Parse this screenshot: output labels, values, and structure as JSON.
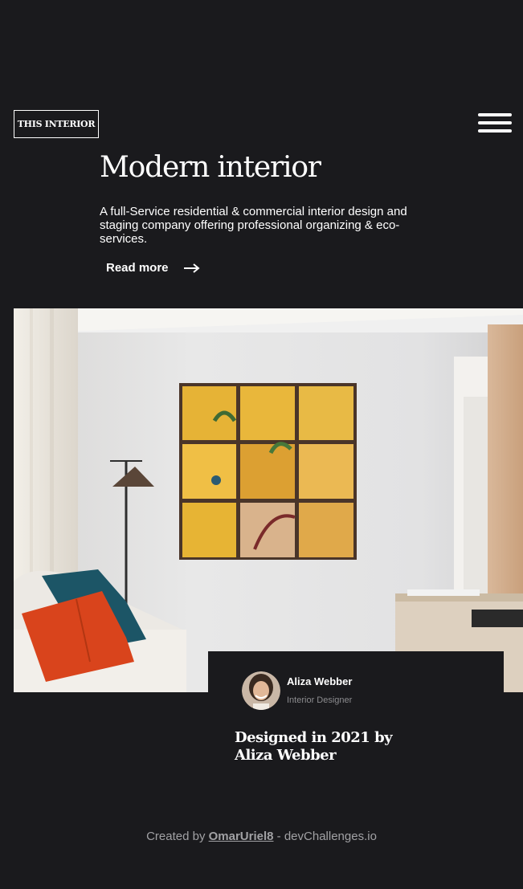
{
  "header": {
    "logo_text": "THIS INTERIOR",
    "menu_icon": "hamburger-menu-icon"
  },
  "hero": {
    "title": "Modern interior",
    "description": "A full-Service residential & commercial interior design and staging company offering professional organizing & eco-services.",
    "read_more_label": "Read more",
    "read_more_icon": "arrow-right-icon"
  },
  "card": {
    "author_name": "Aliza Webber",
    "author_role": "Interior Designer",
    "title": "Designed in 2021 by Aliza Webber"
  },
  "footer": {
    "prefix": "Created by ",
    "author_link": "OmarUriel8",
    "separator": " - ",
    "site": "devChallenges.io"
  },
  "colors": {
    "background": "#1a1a1d",
    "text": "#ffffff",
    "muted_text": "#a1a1a4",
    "role_text": "#8c8c8f"
  }
}
